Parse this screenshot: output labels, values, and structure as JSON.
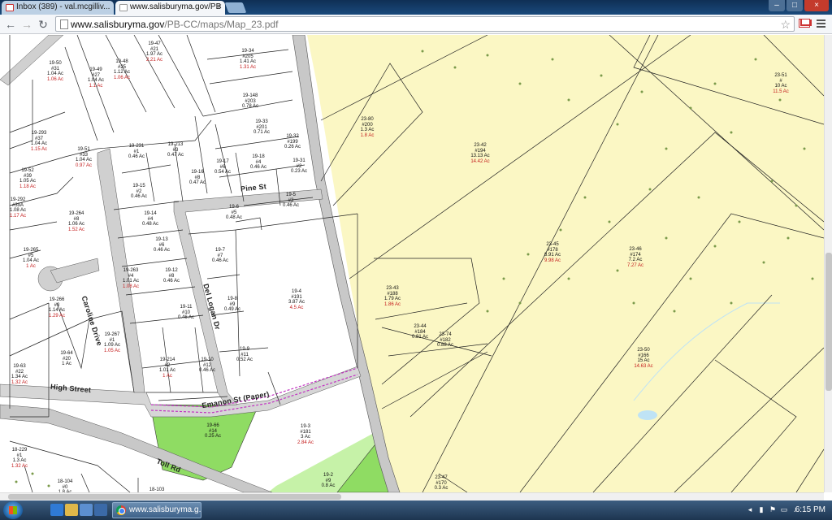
{
  "browser": {
    "tabs": [
      {
        "label": "Inbox (389) - val.mcgilliv...",
        "state": "inactive"
      },
      {
        "label": "www.salisburyma.gov/PB",
        "state": "active"
      }
    ],
    "url_domain": "www.salisburyma.gov",
    "url_path": "/PB-CC/maps/Map_23.pdf",
    "icons": [
      "back-arrow-icon",
      "forward-arrow-icon",
      "reload-icon",
      "star-icon",
      "gmail-icon",
      "menu-icon"
    ]
  },
  "map": {
    "streets": [
      "Pine St",
      "Caroline Drive",
      "Del Logan Dr",
      "High Street",
      "Emanon St (Paper)",
      "Toll Rd"
    ],
    "parcels": [
      {
        "id": "19-47",
        "num": "#21",
        "area": "1.97 Ac",
        "red": "2.21 Ac"
      },
      {
        "id": "19-50",
        "num": "#31",
        "area": "1.04 Ac",
        "red": "1.06 Ac"
      },
      {
        "id": "19-49",
        "num": "#27",
        "area": "1.04 Ac",
        "red": "1.1 Ac"
      },
      {
        "id": "19-48",
        "num": "#25",
        "area": "1.12 Ac",
        "red": "1.06 Ac"
      },
      {
        "id": "19-34",
        "num": "#205",
        "area": "1.41 Ac",
        "red": "1.31 Ac"
      },
      {
        "id": "19-148",
        "num": "#203",
        "area": "0.78 Ac",
        "red": ""
      },
      {
        "id": "19-33",
        "num": "#201",
        "area": "0.71 Ac",
        "red": ""
      },
      {
        "id": "19-32",
        "num": "#199",
        "area": "0.26 Ac",
        "red": ""
      },
      {
        "id": "19-293",
        "num": "#37",
        "area": "1.04 Ac",
        "red": "1.15 Ac"
      },
      {
        "id": "19-51",
        "num": "#33",
        "area": "1.04 Ac",
        "red": "0.97 Ac"
      },
      {
        "id": "19-231",
        "num": "#1",
        "area": "0.46 Ac",
        "red": ""
      },
      {
        "id": "19-213",
        "num": "#3",
        "area": "0.47 Ac",
        "red": ""
      },
      {
        "id": "19-18",
        "num": "#4",
        "area": "0.46 Ac",
        "red": ""
      },
      {
        "id": "19-31",
        "num": "#2",
        "area": "0.23 Ac",
        "red": ""
      },
      {
        "id": "19-52",
        "num": "#39",
        "area": "1.05 Ac",
        "red": "1.18 Ac"
      },
      {
        "id": "19-17",
        "num": "#6",
        "area": "0.54 Ac",
        "red": ""
      },
      {
        "id": "19-16",
        "num": "#8",
        "area": "0.47 Ac",
        "red": ""
      },
      {
        "id": "19-15",
        "num": "#2",
        "area": "0.46 Ac",
        "red": ""
      },
      {
        "id": "19-292",
        "num": "#39A",
        "area": "1.08 Ac",
        "red": "1.17 Ac"
      },
      {
        "id": "19-264",
        "num": "#8",
        "area": "1.06 Ac",
        "red": "1.52 Ac"
      },
      {
        "id": "19-14",
        "num": "#4",
        "area": "0.48 Ac",
        "red": ""
      },
      {
        "id": "19-6",
        "num": "#5",
        "area": "0.48 Ac",
        "red": ""
      },
      {
        "id": "19-5",
        "num": "#3",
        "area": "0.46 Ac",
        "red": ""
      },
      {
        "id": "19-265",
        "num": "#5",
        "area": "1.04 Ac",
        "red": "1 Ac"
      },
      {
        "id": "19-13",
        "num": "#6",
        "area": "0.46 Ac",
        "red": ""
      },
      {
        "id": "19-7",
        "num": "#7",
        "area": "0.46 Ac",
        "red": ""
      },
      {
        "id": "19-263",
        "num": "#4",
        "area": "1.01 Ac",
        "red": "1.08 Ac"
      },
      {
        "id": "19-12",
        "num": "#8",
        "area": "0.46 Ac",
        "red": ""
      },
      {
        "id": "19-4",
        "num": "#191",
        "area": "3.87 Ac",
        "red": "4.5 Ac"
      },
      {
        "id": "19-266",
        "num": "#3",
        "area": "1.14 Ac",
        "red": "1.29 Ac"
      },
      {
        "id": "19-11",
        "num": "#10",
        "area": "0.46 Ac",
        "red": ""
      },
      {
        "id": "19-8",
        "num": "#9",
        "area": "0.49 Ac",
        "red": ""
      },
      {
        "id": "19-267",
        "num": "#1",
        "area": "1.09 Ac",
        "red": "1.05 Ac"
      },
      {
        "id": "19-64",
        "num": "#20",
        "area": "1 Ac",
        "red": ""
      },
      {
        "id": "19-214",
        "num": "#2",
        "area": "1.01 Ac",
        "red": "1 Ac"
      },
      {
        "id": "19-10",
        "num": "#12",
        "area": "0.46 Ac",
        "red": ""
      },
      {
        "id": "19-9",
        "num": "#11",
        "area": "0.52 Ac",
        "red": ""
      },
      {
        "id": "19-63",
        "num": "#22",
        "area": "1.34 Ac",
        "red": "1.32 Ac"
      },
      {
        "id": "19-66",
        "num": "#14",
        "area": "0.25 Ac",
        "red": ""
      },
      {
        "id": "19-3",
        "num": "#181",
        "area": "3 Ac",
        "red": "2.84 Ac"
      },
      {
        "id": "18-229",
        "num": "#1",
        "area": "1.3 Ac",
        "red": "1.32 Ac"
      },
      {
        "id": "19-2",
        "num": "#9",
        "area": "0.8 Ac",
        "red": ""
      },
      {
        "id": "18-104",
        "num": "#0",
        "area": "1.8 Ac",
        "red": ""
      },
      {
        "id": "18-103",
        "num": "",
        "area": "",
        "red": ""
      },
      {
        "id": "23-80",
        "num": "#200",
        "area": "1.3 Ac",
        "red": "1.8 Ac"
      },
      {
        "id": "23-42",
        "num": "#194",
        "area": "13.13 Ac",
        "red": "14.42 Ac"
      },
      {
        "id": "23-51",
        "num": "#",
        "area": "10 Ac",
        "red": "11.5 Ac"
      },
      {
        "id": "23-45",
        "num": "#178",
        "area": "8.91 Ac",
        "red": "9.98 Ac"
      },
      {
        "id": "23-46",
        "num": "#174",
        "area": "7.2 Ac",
        "red": "7.27 Ac"
      },
      {
        "id": "23-43",
        "num": "#188",
        "area": "1.79 Ac",
        "red": "1.86 Ac"
      },
      {
        "id": "23-44",
        "num": "#184",
        "area": "0.81 Ac",
        "red": ""
      },
      {
        "id": "23-74",
        "num": "#182",
        "area": "0.88 Ac",
        "red": ""
      },
      {
        "id": "23-50",
        "num": "#166",
        "area": "15 Ac",
        "red": "14.63 Ac"
      },
      {
        "id": "23-47",
        "num": "#170",
        "area": "0.3 Ac",
        "red": ""
      }
    ]
  },
  "taskbar": {
    "task_label": "www.salisburyma.g...",
    "clock": "6:15 PM"
  },
  "colors": {
    "yellow_zone": "#fbf7c4",
    "green_parcel": "#8fdc63",
    "light_green": "#c6f2a8",
    "road": "#c8c8c8",
    "emanon_line": "#c233c2",
    "red_text": "#c41d1d"
  }
}
